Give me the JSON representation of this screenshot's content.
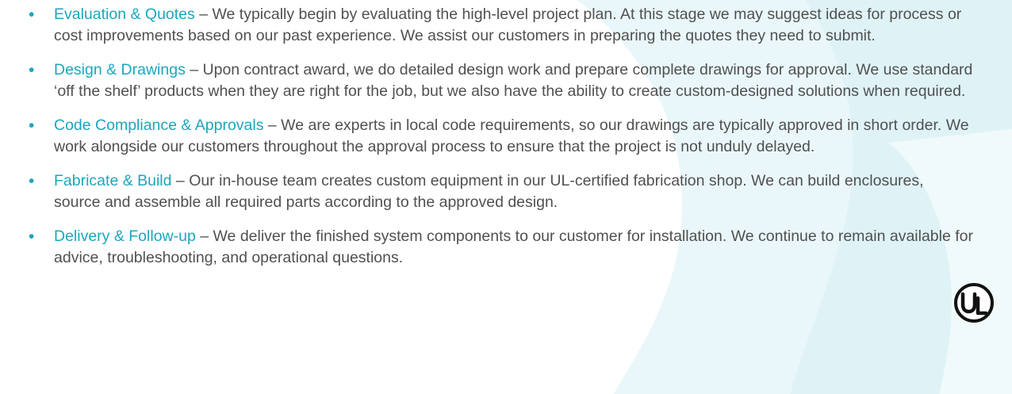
{
  "colors": {
    "accent": "#1aa7bd",
    "text": "#505050",
    "background_swirl": "#e6f6f9"
  },
  "items": [
    {
      "bullet": "•",
      "term": "Evaluation & Quotes",
      "separator": " – ",
      "description": "We typically begin by evaluating the high-level project plan. At this stage we may suggest ideas for process or cost improvements based on our past experience. We assist our customers in preparing the quotes they need to submit."
    },
    {
      "bullet": "•",
      "term": "Design & Drawings",
      "separator": " – ",
      "description": "Upon contract award, we do detailed design work and prepare complete drawings for approval. We use standard ‘off the shelf’ products when they are right for the job, but we also have the ability to create custom-designed solutions when required."
    },
    {
      "bullet": "•",
      "term": "Code Compliance & Approvals",
      "separator": " – ",
      "description": "We are experts in local code requirements, so our drawings are typically approved in short order. We work alongside our customers throughout the approval process to ensure that the project is not unduly delayed."
    },
    {
      "bullet": "•",
      "term": "Fabricate & Build",
      "separator": " – ",
      "description": "Our in-house team creates custom equipment in our UL-certified fabrication shop. We can build enclosures, source and assemble all required parts according to the approved design."
    },
    {
      "bullet": "•",
      "term": "Delivery & Follow-up",
      "separator": " – ",
      "description": "We deliver the finished system components to our customer for installation. We continue to remain available for advice, troubleshooting, and operational questions."
    }
  ],
  "ul_logo": {
    "icon": "ul-certification-logo",
    "text": "UL"
  }
}
